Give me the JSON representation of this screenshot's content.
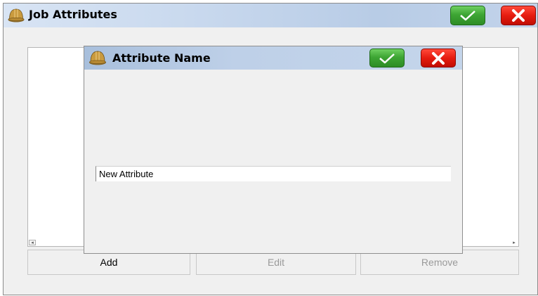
{
  "window": {
    "title": "Job Attributes",
    "icon": "hard-hat-icon",
    "ok_icon": "checkmark-icon",
    "cancel_icon": "close-x-icon"
  },
  "buttons": {
    "add": "Add",
    "edit": "Edit",
    "remove": "Remove"
  },
  "dialog": {
    "title": "Attribute Name",
    "icon": "hard-hat-icon",
    "input_value": "New Attribute"
  },
  "colors": {
    "ok_green": "#3ea534",
    "cancel_red": "#e61c10",
    "titlebar_blue": "#c9d9ee"
  }
}
